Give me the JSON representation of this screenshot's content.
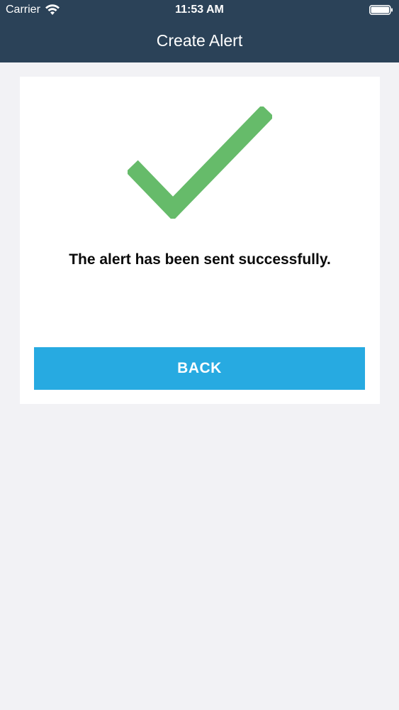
{
  "status_bar": {
    "carrier": "Carrier",
    "time": "11:53 AM",
    "wifi_icon": "wifi-icon",
    "battery_icon": "battery-icon"
  },
  "header": {
    "title": "Create Alert",
    "background_color": "#2b4258"
  },
  "card": {
    "icon": "checkmark-icon",
    "icon_color": "#66bb6a",
    "message": "The alert has been sent successfully.",
    "button_label": "BACK",
    "button_color": "#27aae1"
  }
}
